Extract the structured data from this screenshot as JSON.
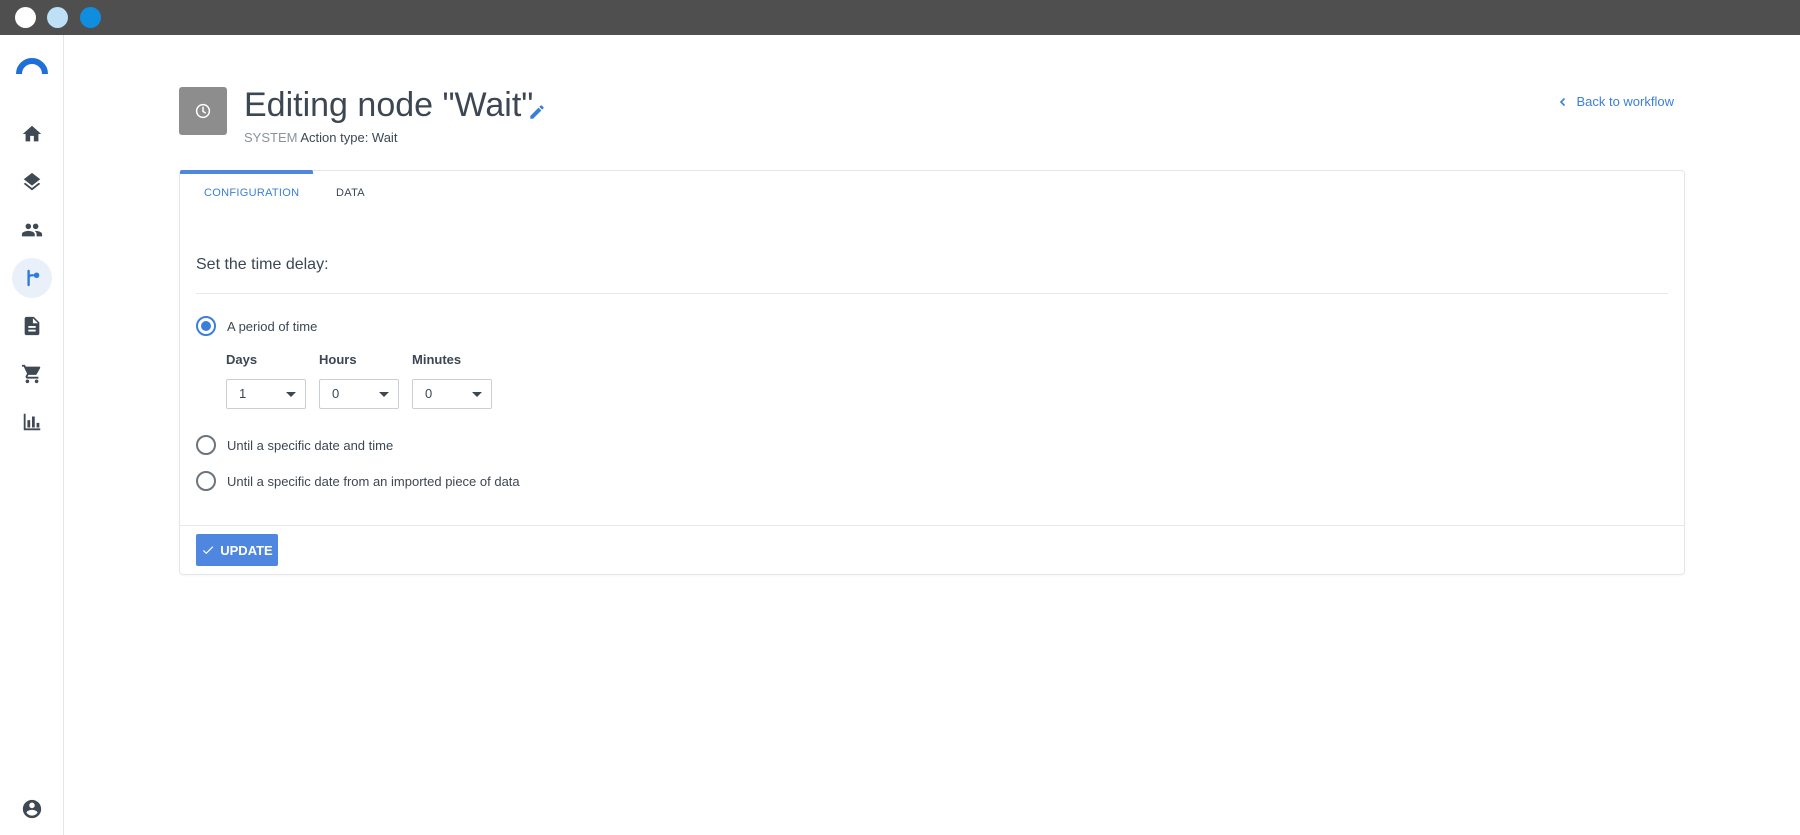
{
  "window": {
    "controls": [
      "close",
      "minimize",
      "maximize"
    ]
  },
  "sidebar": {
    "items": [
      {
        "name": "home",
        "icon": "home-icon"
      },
      {
        "name": "layers",
        "icon": "layers-icon"
      },
      {
        "name": "contacts",
        "icon": "people-icon"
      },
      {
        "name": "workflows",
        "icon": "workflow-branch-icon",
        "active": true
      },
      {
        "name": "documents",
        "icon": "document-icon"
      },
      {
        "name": "commerce",
        "icon": "cart-icon"
      },
      {
        "name": "reports",
        "icon": "bar-chart-icon"
      }
    ],
    "bottom": {
      "name": "account",
      "icon": "account-circle-icon"
    }
  },
  "header": {
    "icon": "clock-icon",
    "title": "Editing node \"Wait\"",
    "system_tag": "SYSTEM",
    "action_type": "Action type: Wait",
    "back_label": "Back to workflow"
  },
  "tabs": [
    {
      "label": "CONFIGURATION",
      "active": true
    },
    {
      "label": "DATA",
      "active": false
    }
  ],
  "config": {
    "section_title": "Set the time delay:",
    "options": [
      {
        "label": "A period of time",
        "checked": true
      },
      {
        "label": "Until a specific date and time",
        "checked": false
      },
      {
        "label": "Until a specific date from an imported piece of data",
        "checked": false
      }
    ],
    "fields": {
      "days": {
        "label": "Days",
        "value": "1"
      },
      "hours": {
        "label": "Hours",
        "value": "0"
      },
      "minutes": {
        "label": "Minutes",
        "value": "0"
      }
    }
  },
  "footer": {
    "update_label": "UPDATE"
  },
  "colors": {
    "accent": "#4f87e0",
    "link": "#3c7fd8",
    "text": "#3d4753",
    "titlebar": "#4f4f4f"
  }
}
